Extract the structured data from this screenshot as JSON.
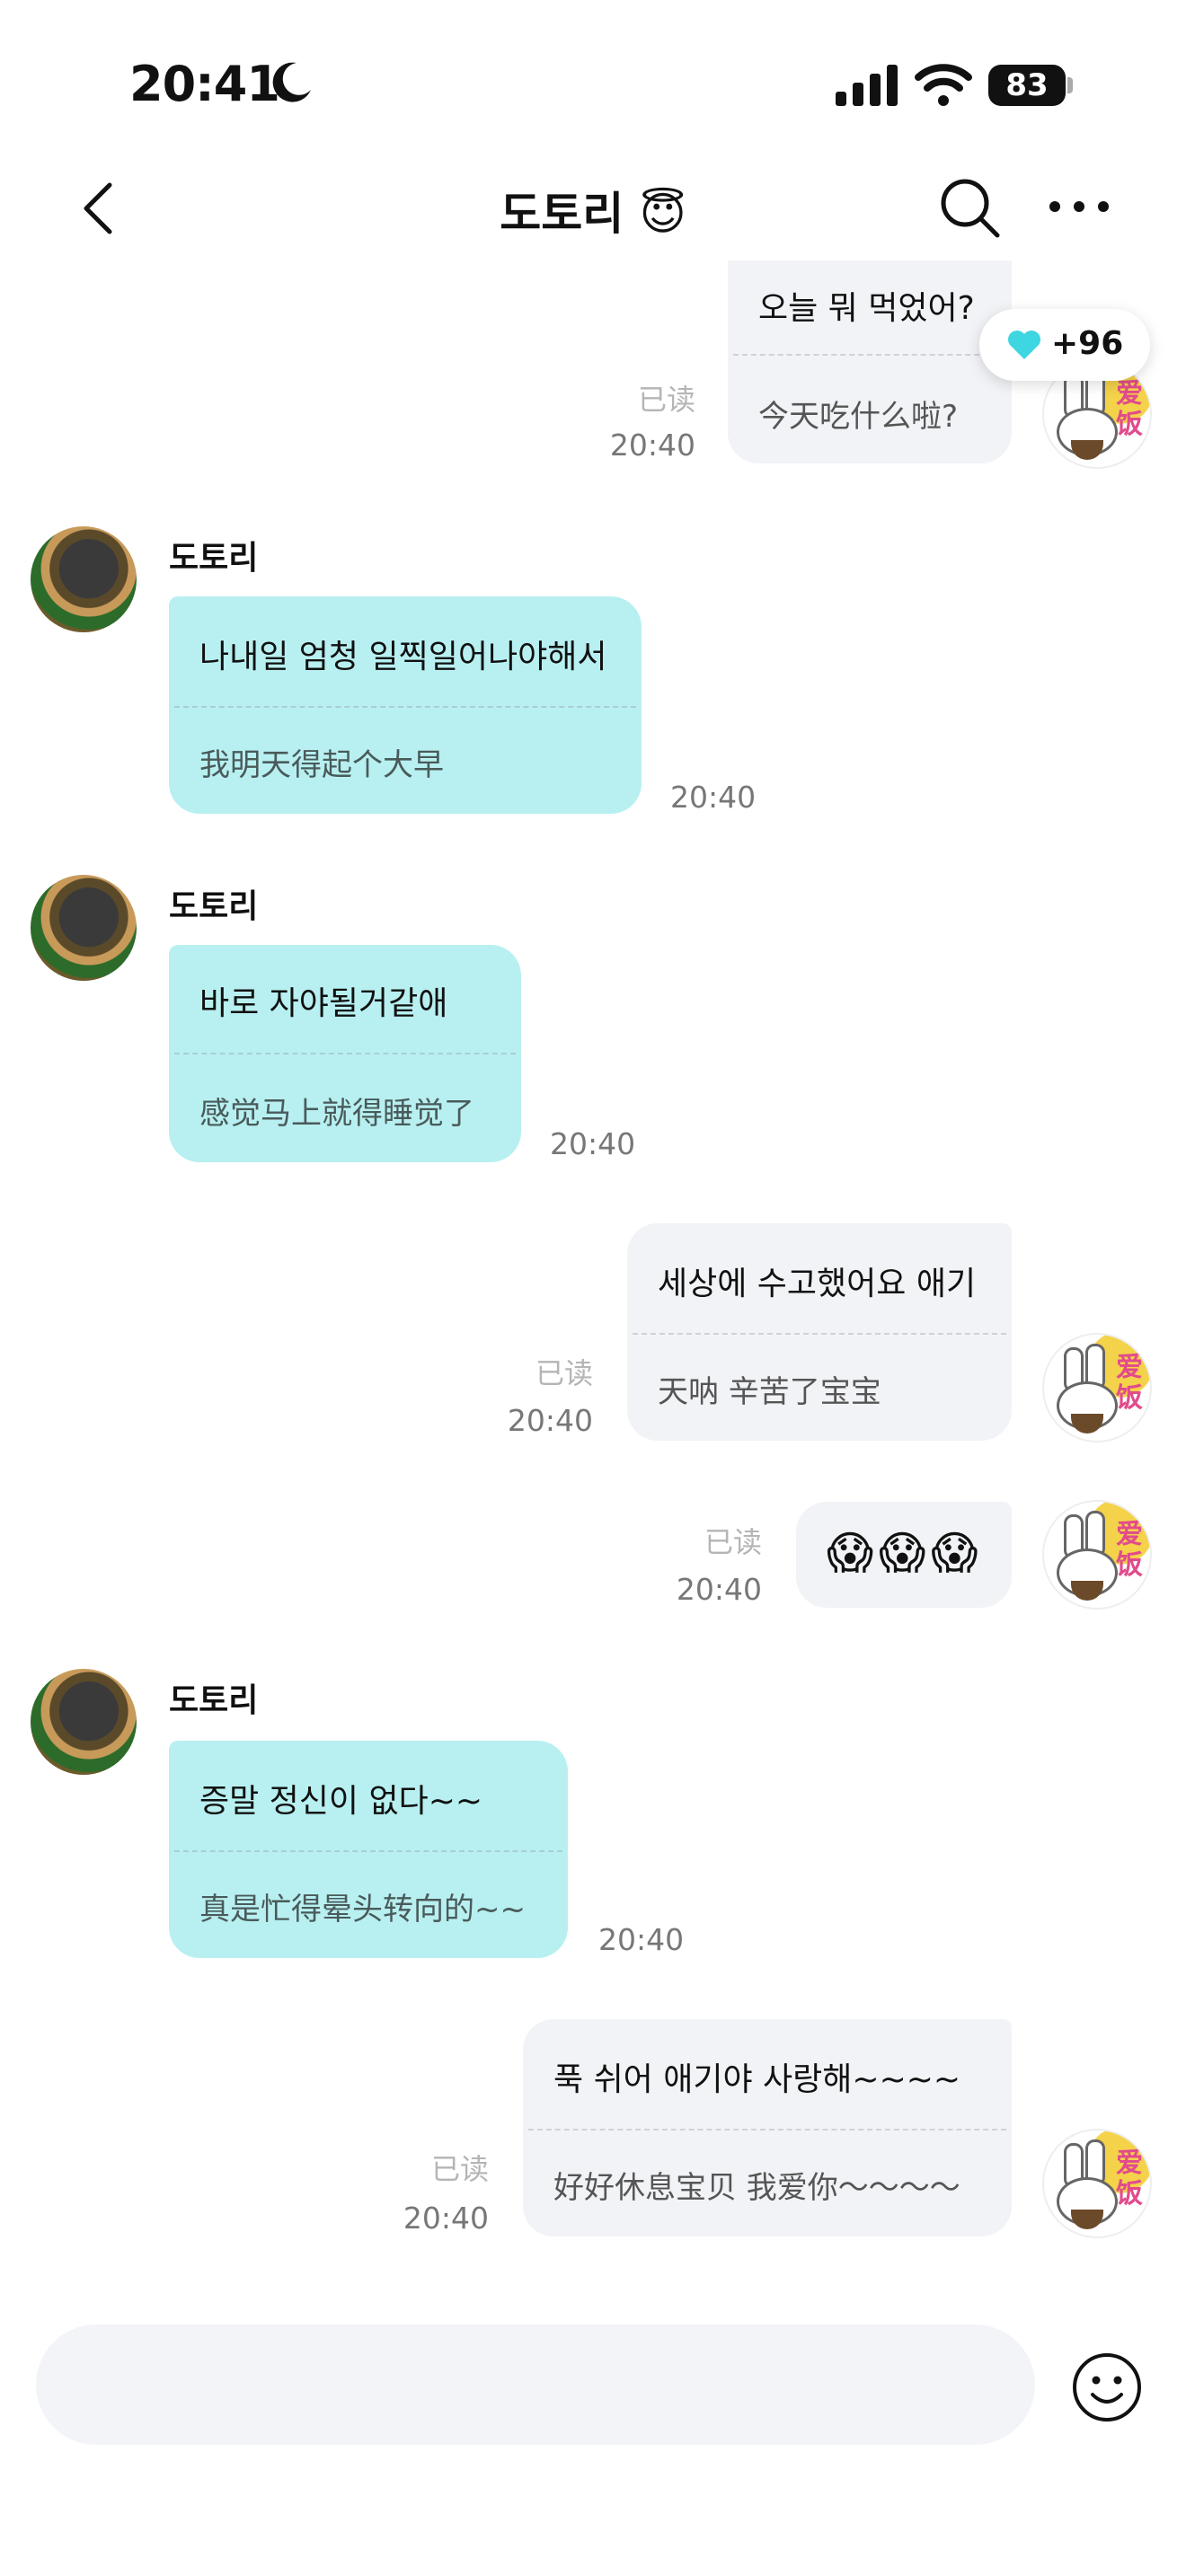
{
  "status_bar": {
    "time": "20:41",
    "battery": "83"
  },
  "header": {
    "title": "도토리 😇"
  },
  "reaction": {
    "count": "+96",
    "color": "#3ed6e0"
  },
  "messages": [
    {
      "side": "out",
      "text": "오늘 뭐 먹었어?",
      "translation": "今天吃什么啦?",
      "read": "已读",
      "time": "20:40"
    },
    {
      "side": "in",
      "sender": "도토리",
      "text": "나내일 엄청 일찍일어나야해서",
      "translation": "我明天得起个大早",
      "time": "20:40"
    },
    {
      "side": "in",
      "sender": "도토리",
      "text": "바로 자야될거같애",
      "translation": "感觉马上就得睡觉了",
      "time": "20:40"
    },
    {
      "side": "out",
      "text": "세상에 수고했어요 애기",
      "translation": "天呐 辛苦了宝宝",
      "read": "已读",
      "time": "20:40"
    },
    {
      "side": "out",
      "text": "😱😱😱",
      "read": "已读",
      "time": "20:40"
    },
    {
      "side": "in",
      "sender": "도토리",
      "text": "증말 정신이 없다~~",
      "translation": "真是忙得晕头转向的~~",
      "time": "20:40"
    },
    {
      "side": "out",
      "text": "푹 쉬어 애기야 사랑해~~~~",
      "translation": "好好休息宝贝 我爱你～～～～",
      "read": "已读",
      "time": "20:40"
    }
  ],
  "avatar_sticker_text": "爱饭",
  "colors": {
    "incoming_bubble": "#b8f0f1",
    "outgoing_bubble": "#f2f3f6"
  }
}
